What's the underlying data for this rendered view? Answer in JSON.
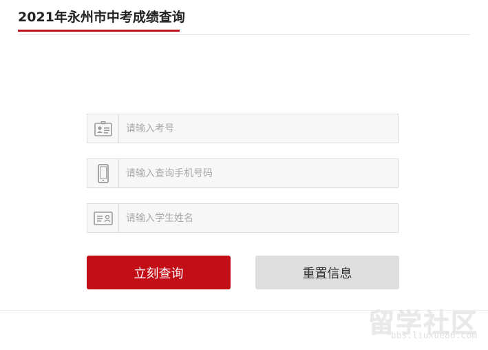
{
  "header": {
    "title": "2021年永州市中考成绩查询"
  },
  "form": {
    "fields": [
      {
        "icon": "id-badge-icon",
        "placeholder": "请输入考号",
        "value": ""
      },
      {
        "icon": "mobile-phone-icon",
        "placeholder": "请输入查询手机号码",
        "value": ""
      },
      {
        "icon": "name-card-icon",
        "placeholder": "请输入学生姓名",
        "value": ""
      }
    ],
    "query_label": "立刻查询",
    "reset_label": "重置信息"
  },
  "colors": {
    "accent": "#c30d17",
    "reset_bg": "#dedede"
  },
  "watermark": {
    "main": "留学社区",
    "sub": "bbs.liuxue86.com"
  }
}
